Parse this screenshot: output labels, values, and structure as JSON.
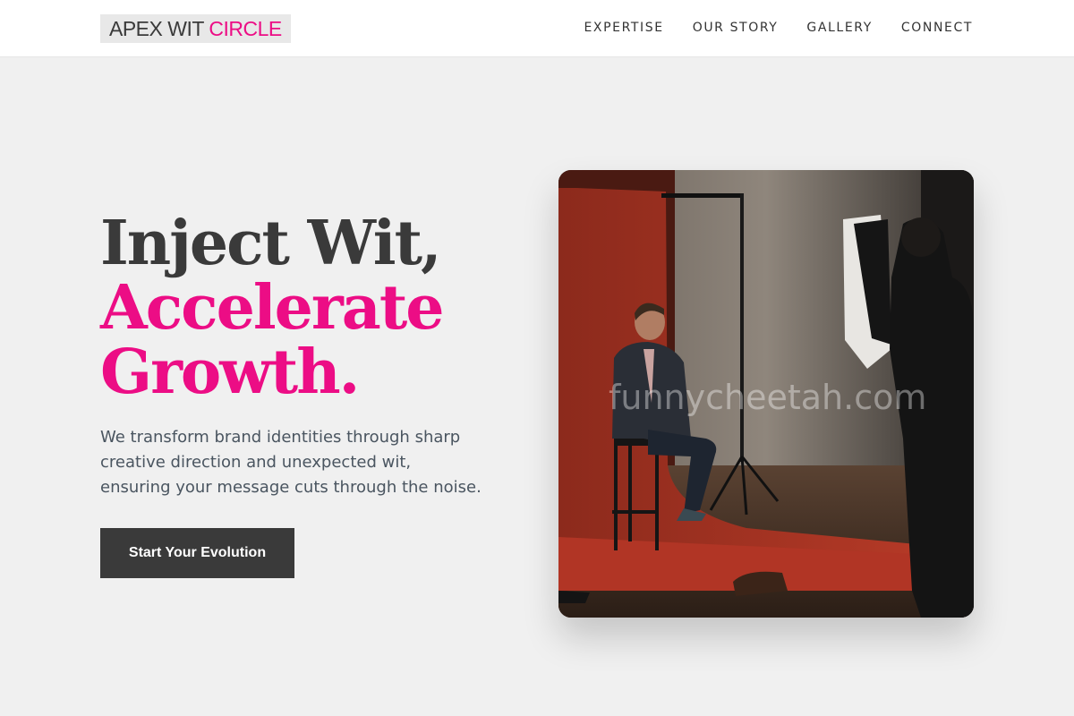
{
  "header": {
    "logo": {
      "main": "APEX WIT ",
      "accent": "CIRCLE"
    },
    "nav": [
      "EXPERTISE",
      "OUR STORY",
      "GALLERY",
      "CONNECT"
    ]
  },
  "hero": {
    "title_lines": [
      "Inject Wit,",
      "Accelerate",
      "Growth."
    ],
    "description_lines": [
      "We transform brand identities through sharp",
      "creative direction and unexpected wit,",
      "ensuring your message cuts through the noise."
    ],
    "cta_label": "Start Your Evolution",
    "image": {
      "watermark": "funnycheetah.com"
    }
  },
  "colors": {
    "accent": "#ec0d85",
    "dark": "#3a3a3a",
    "background": "#f0f0f0",
    "header": "#ffffff"
  }
}
